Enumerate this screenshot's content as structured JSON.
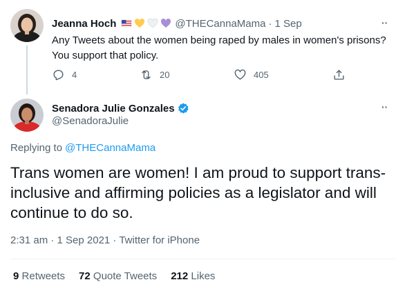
{
  "parent_tweet": {
    "author_name": "Jeanna Hoch",
    "emoji_flags": [
      "us-flag-icon",
      "yellow-heart-icon",
      "white-heart-icon",
      "purple-heart-icon"
    ],
    "handle": "@THECannaMama",
    "separator": "·",
    "date": "1 Sep",
    "text_line1": "Any Tweets about the women being raped by males in women's prisons?",
    "text_line2": "You support that policy.",
    "replies": "4",
    "retweets": "20",
    "likes": "405",
    "more": "··"
  },
  "main_tweet": {
    "author_name": "Senadora Julie Gonzales",
    "verified": true,
    "handle": "@SenadoraJulie",
    "more": "··",
    "replying_to_prefix": "Replying to",
    "replying_to_handle": "@THECannaMama",
    "text": "Trans women are women! I am proud to support trans-inclusive and affirming policies as a legislator and will continue to do so.",
    "timestamp": "2:31 am · 1 Sep 2021 · Twitter for iPhone",
    "stats": {
      "retweets_count": "9",
      "retweets_label": "Retweets",
      "quote_count": "72",
      "quote_label": "Quote Tweets",
      "likes_count": "212",
      "likes_label": "Likes"
    }
  },
  "colors": {
    "accent": "#1d9bf0",
    "muted": "#536471",
    "text": "#0f1419",
    "divider": "#eff3f4"
  }
}
